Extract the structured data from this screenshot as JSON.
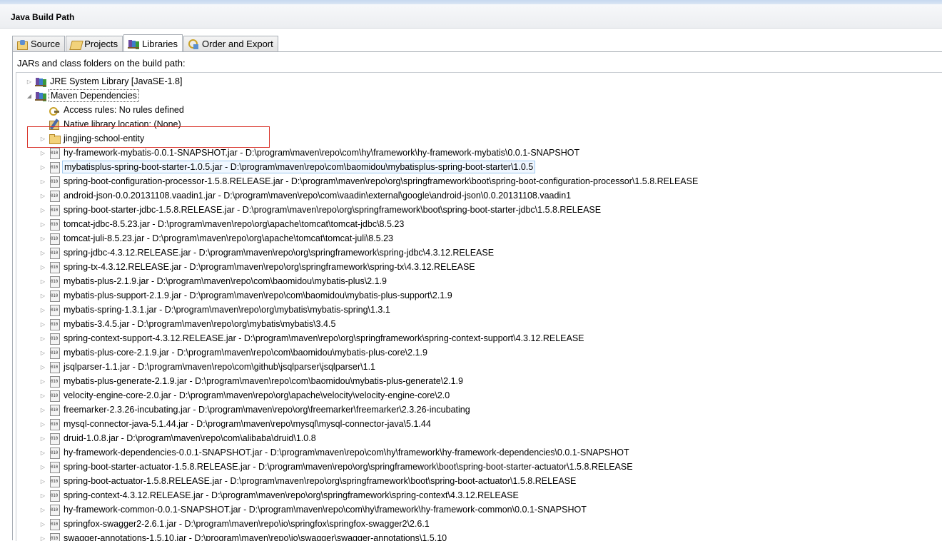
{
  "window": {
    "title": "Java Build Path"
  },
  "tabs": [
    {
      "label": "Source",
      "icon": "source-folder-icon",
      "active": false
    },
    {
      "label": "Projects",
      "icon": "projects-icon",
      "active": false
    },
    {
      "label": "Libraries",
      "icon": "libraries-icon",
      "active": true
    },
    {
      "label": "Order and Export",
      "icon": "order-export-icon",
      "active": false
    }
  ],
  "panel": {
    "label": "JARs and class folders on the build path:"
  },
  "tree": [
    {
      "text": "JRE System Library [JavaSE-1.8]",
      "icon": "library-icon",
      "level": 0,
      "twisty": "collapsed"
    },
    {
      "text": "Maven Dependencies",
      "icon": "library-icon",
      "level": 0,
      "twisty": "expanded",
      "selected": true
    },
    {
      "text": "Access rules: No rules defined",
      "icon": "access-rules-icon",
      "level": 1,
      "twisty": "none"
    },
    {
      "text": "Native library location: (None)",
      "icon": "native-library-icon",
      "level": 1,
      "twisty": "none"
    },
    {
      "text": "jingjing-school-entity",
      "icon": "project-folder-icon",
      "level": 1,
      "twisty": "collapsed",
      "highlighted": true
    },
    {
      "text": "hy-framework-mybatis-0.0.1-SNAPSHOT.jar - D:\\program\\maven\\repo\\com\\hy\\framework\\hy-framework-mybatis\\0.0.1-SNAPSHOT",
      "icon": "jar-icon",
      "level": 1,
      "twisty": "collapsed"
    },
    {
      "text": "mybatisplus-spring-boot-starter-1.0.5.jar - D:\\program\\maven\\repo\\com\\baomidou\\mybatisplus-spring-boot-starter\\1.0.5",
      "icon": "jar-icon",
      "level": 1,
      "twisty": "collapsed",
      "hover": true
    },
    {
      "text": "spring-boot-configuration-processor-1.5.8.RELEASE.jar - D:\\program\\maven\\repo\\org\\springframework\\boot\\spring-boot-configuration-processor\\1.5.8.RELEASE",
      "icon": "jar-icon",
      "level": 1,
      "twisty": "collapsed"
    },
    {
      "text": "android-json-0.0.20131108.vaadin1.jar - D:\\program\\maven\\repo\\com\\vaadin\\external\\google\\android-json\\0.0.20131108.vaadin1",
      "icon": "jar-icon",
      "level": 1,
      "twisty": "collapsed"
    },
    {
      "text": "spring-boot-starter-jdbc-1.5.8.RELEASE.jar - D:\\program\\maven\\repo\\org\\springframework\\boot\\spring-boot-starter-jdbc\\1.5.8.RELEASE",
      "icon": "jar-icon",
      "level": 1,
      "twisty": "collapsed"
    },
    {
      "text": "tomcat-jdbc-8.5.23.jar - D:\\program\\maven\\repo\\org\\apache\\tomcat\\tomcat-jdbc\\8.5.23",
      "icon": "jar-icon",
      "level": 1,
      "twisty": "collapsed"
    },
    {
      "text": "tomcat-juli-8.5.23.jar - D:\\program\\maven\\repo\\org\\apache\\tomcat\\tomcat-juli\\8.5.23",
      "icon": "jar-icon",
      "level": 1,
      "twisty": "collapsed"
    },
    {
      "text": "spring-jdbc-4.3.12.RELEASE.jar - D:\\program\\maven\\repo\\org\\springframework\\spring-jdbc\\4.3.12.RELEASE",
      "icon": "jar-icon",
      "level": 1,
      "twisty": "collapsed"
    },
    {
      "text": "spring-tx-4.3.12.RELEASE.jar - D:\\program\\maven\\repo\\org\\springframework\\spring-tx\\4.3.12.RELEASE",
      "icon": "jar-icon",
      "level": 1,
      "twisty": "collapsed"
    },
    {
      "text": "mybatis-plus-2.1.9.jar - D:\\program\\maven\\repo\\com\\baomidou\\mybatis-plus\\2.1.9",
      "icon": "jar-icon",
      "level": 1,
      "twisty": "collapsed"
    },
    {
      "text": "mybatis-plus-support-2.1.9.jar - D:\\program\\maven\\repo\\com\\baomidou\\mybatis-plus-support\\2.1.9",
      "icon": "jar-icon",
      "level": 1,
      "twisty": "collapsed"
    },
    {
      "text": "mybatis-spring-1.3.1.jar - D:\\program\\maven\\repo\\org\\mybatis\\mybatis-spring\\1.3.1",
      "icon": "jar-icon",
      "level": 1,
      "twisty": "collapsed"
    },
    {
      "text": "mybatis-3.4.5.jar - D:\\program\\maven\\repo\\org\\mybatis\\mybatis\\3.4.5",
      "icon": "jar-icon",
      "level": 1,
      "twisty": "collapsed"
    },
    {
      "text": "spring-context-support-4.3.12.RELEASE.jar - D:\\program\\maven\\repo\\org\\springframework\\spring-context-support\\4.3.12.RELEASE",
      "icon": "jar-icon",
      "level": 1,
      "twisty": "collapsed"
    },
    {
      "text": "mybatis-plus-core-2.1.9.jar - D:\\program\\maven\\repo\\com\\baomidou\\mybatis-plus-core\\2.1.9",
      "icon": "jar-icon",
      "level": 1,
      "twisty": "collapsed"
    },
    {
      "text": "jsqlparser-1.1.jar - D:\\program\\maven\\repo\\com\\github\\jsqlparser\\jsqlparser\\1.1",
      "icon": "jar-icon",
      "level": 1,
      "twisty": "collapsed"
    },
    {
      "text": "mybatis-plus-generate-2.1.9.jar - D:\\program\\maven\\repo\\com\\baomidou\\mybatis-plus-generate\\2.1.9",
      "icon": "jar-icon",
      "level": 1,
      "twisty": "collapsed"
    },
    {
      "text": "velocity-engine-core-2.0.jar - D:\\program\\maven\\repo\\org\\apache\\velocity\\velocity-engine-core\\2.0",
      "icon": "jar-icon",
      "level": 1,
      "twisty": "collapsed"
    },
    {
      "text": "freemarker-2.3.26-incubating.jar - D:\\program\\maven\\repo\\org\\freemarker\\freemarker\\2.3.26-incubating",
      "icon": "jar-icon",
      "level": 1,
      "twisty": "collapsed"
    },
    {
      "text": "mysql-connector-java-5.1.44.jar - D:\\program\\maven\\repo\\mysql\\mysql-connector-java\\5.1.44",
      "icon": "jar-icon",
      "level": 1,
      "twisty": "collapsed"
    },
    {
      "text": "druid-1.0.8.jar - D:\\program\\maven\\repo\\com\\alibaba\\druid\\1.0.8",
      "icon": "jar-icon",
      "level": 1,
      "twisty": "collapsed"
    },
    {
      "text": "hy-framework-dependencies-0.0.1-SNAPSHOT.jar - D:\\program\\maven\\repo\\com\\hy\\framework\\hy-framework-dependencies\\0.0.1-SNAPSHOT",
      "icon": "jar-icon",
      "level": 1,
      "twisty": "collapsed"
    },
    {
      "text": "spring-boot-starter-actuator-1.5.8.RELEASE.jar - D:\\program\\maven\\repo\\org\\springframework\\boot\\spring-boot-starter-actuator\\1.5.8.RELEASE",
      "icon": "jar-icon",
      "level": 1,
      "twisty": "collapsed"
    },
    {
      "text": "spring-boot-actuator-1.5.8.RELEASE.jar - D:\\program\\maven\\repo\\org\\springframework\\boot\\spring-boot-actuator\\1.5.8.RELEASE",
      "icon": "jar-icon",
      "level": 1,
      "twisty": "collapsed"
    },
    {
      "text": "spring-context-4.3.12.RELEASE.jar - D:\\program\\maven\\repo\\org\\springframework\\spring-context\\4.3.12.RELEASE",
      "icon": "jar-icon",
      "level": 1,
      "twisty": "collapsed"
    },
    {
      "text": "hy-framework-common-0.0.1-SNAPSHOT.jar - D:\\program\\maven\\repo\\com\\hy\\framework\\hy-framework-common\\0.0.1-SNAPSHOT",
      "icon": "jar-icon",
      "level": 1,
      "twisty": "collapsed"
    },
    {
      "text": "springfox-swagger2-2.6.1.jar - D:\\program\\maven\\repo\\io\\springfox\\springfox-swagger2\\2.6.1",
      "icon": "jar-icon",
      "level": 1,
      "twisty": "collapsed"
    },
    {
      "text": "swagger-annotations-1.5.10.jar - D:\\program\\maven\\repo\\io\\swagger\\swagger-annotations\\1.5.10",
      "icon": "jar-icon",
      "level": 1,
      "twisty": "collapsed"
    }
  ]
}
